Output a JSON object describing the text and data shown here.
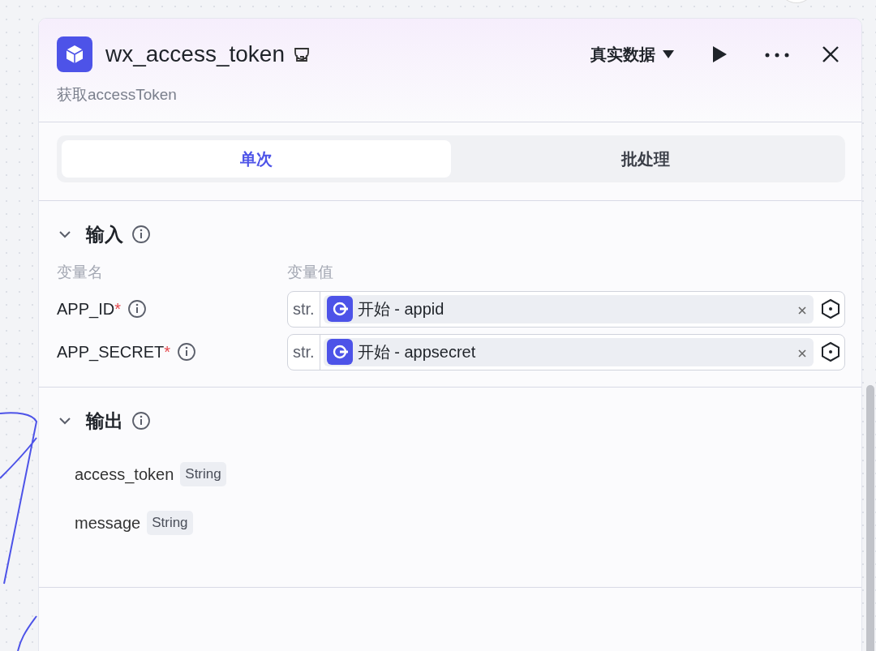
{
  "node": {
    "title": "wx_access_token",
    "description": "获取accessToken",
    "data_mode": "真实数据"
  },
  "tabs": [
    {
      "label": "单次",
      "selected": true
    },
    {
      "label": "批处理",
      "selected": false
    }
  ],
  "input": {
    "title": "输入",
    "expanded": true,
    "columns": [
      "变量名",
      "变量值"
    ],
    "rows": [
      {
        "name": "APP_ID",
        "required_mark": "*",
        "type": "str.",
        "reference": "开始 - appid"
      },
      {
        "name": "APP_SECRET",
        "required_mark": "*",
        "type": "str.",
        "reference": "开始 - appsecret"
      }
    ]
  },
  "output": {
    "title": "输出",
    "expanded": true,
    "rows": [
      {
        "name": "access_token",
        "type": "String"
      },
      {
        "name": "message",
        "type": "String"
      }
    ]
  }
}
